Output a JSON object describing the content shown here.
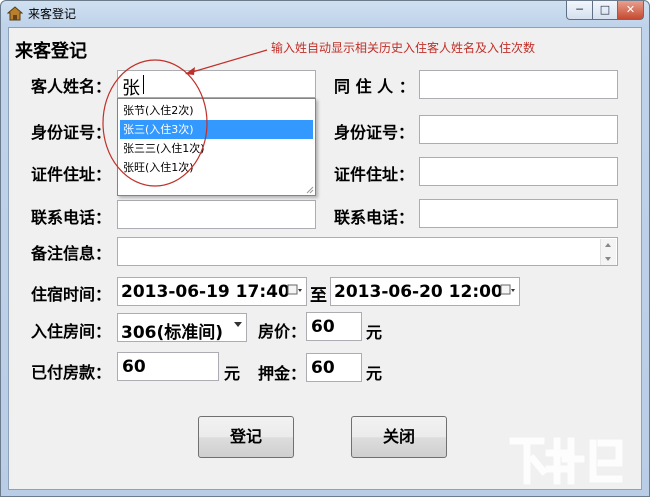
{
  "window": {
    "title": "来客登记",
    "minimize_glyph": "─",
    "maximize_glyph": "□",
    "close_glyph": "✕"
  },
  "form": {
    "heading": "来客登记",
    "annotation": "输入姓自动显示相关历史入住客人姓名及入住次数",
    "guest_name_label": "客人姓名：",
    "guest_name_value": "张",
    "cohabitant_label": "同 住 人 ：",
    "cohabitant_value": "",
    "id_number_label": "身份证号：",
    "id_number_value": "",
    "id_number2_label": "身份证号：",
    "id_number2_value": "",
    "id_address_label": "证件住址：",
    "id_address_value": "",
    "id_address2_label": "证件住址：",
    "id_address2_value": "",
    "phone_label": "联系电话：",
    "phone_value": "",
    "phone2_label": "联系电话：",
    "phone2_value": "",
    "remarks_label": "备注信息：",
    "remarks_value": "",
    "stay_time_label": "住宿时间：",
    "checkin_time": "2013-06-19 17:40",
    "to_label": "至",
    "checkout_time": "2013-06-20 12:00",
    "room_label": "入住房间：",
    "room_value": "306(标准间)",
    "price_label": "房价：",
    "price_value": "60",
    "price_unit": "元",
    "paid_label": "已付房款：",
    "paid_value": "60",
    "paid_unit": "元",
    "deposit_label": "押金：",
    "deposit_value": "60",
    "deposit_unit": "元"
  },
  "suggestions": [
    {
      "label": "张节(入住2次)",
      "selected": false
    },
    {
      "label": "张三(入住3次)",
      "selected": true
    },
    {
      "label": "张三三(入住1次)",
      "selected": false
    },
    {
      "label": "张旺(入住1次)",
      "selected": false
    }
  ],
  "buttons": {
    "register": "登记",
    "close": "关闭"
  },
  "icons": {
    "app": "house-icon",
    "calendar": "calendar-dropdown-icon",
    "watermark": "xiazai-logo"
  },
  "colors": {
    "annotation": "#c0302a",
    "selection": "#3399ff"
  }
}
